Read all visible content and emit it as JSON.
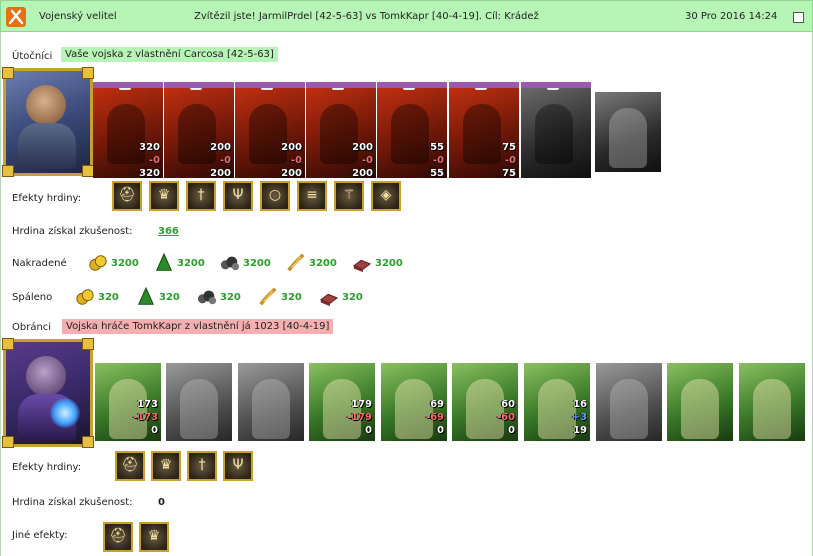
{
  "header": {
    "sender": "Vojenský velitel",
    "subject": "Zvítězil jste! JarmilPrdel [42-5-63] vs TomkKapr [40-4-19]. Cíl: Krádež",
    "date": "30 Pro 2016 14:24"
  },
  "attackers": {
    "label": "Útočníci",
    "tag": "Vaše vojska z vlastnění Carcosa [42-5-63]",
    "units": [
      {
        "icon": "demon-unit-icon",
        "n1": "320",
        "n2": "-0",
        "n3": "320"
      },
      {
        "icon": "fire-lord-unit-icon",
        "n1": "200",
        "n2": "-0",
        "n3": "200"
      },
      {
        "icon": "flame-beast-unit-icon",
        "n1": "200",
        "n2": "-0",
        "n3": "200"
      },
      {
        "icon": "dragon-unit-icon",
        "n1": "200",
        "n2": "-0",
        "n3": "200"
      },
      {
        "icon": "fire-elemental-unit-icon",
        "n1": "55",
        "n2": "-0",
        "n3": "55"
      },
      {
        "icon": "berserker-unit-icon",
        "n1": "75",
        "n2": "-0",
        "n3": "75"
      },
      {
        "icon": "dark-knight-unit-icon",
        "n1": "",
        "n2": "",
        "n3": ""
      },
      {
        "icon": "reaper-unit-icon",
        "n1": "",
        "n2": "",
        "n3": ""
      }
    ],
    "hero_effects_label": "Efekty hrdiny:",
    "hero_effects": [
      "helmet-effect-icon",
      "crown-effect-icon",
      "dagger-effect-icon",
      "trident-effect-icon",
      "ring-effect-icon",
      "scroll-effect-icon",
      "staff-effect-icon",
      "shield-effect-icon"
    ],
    "xp_label": "Hrdina získal zkušenost:",
    "xp_value": "366",
    "stolen_label": "Nakradené",
    "stolen": [
      {
        "icon": "gold-icon",
        "value": "3200"
      },
      {
        "icon": "wood-icon",
        "value": "3200"
      },
      {
        "icon": "ore-icon",
        "value": "3200"
      },
      {
        "icon": "grain-icon",
        "value": "3200"
      },
      {
        "icon": "brick-icon",
        "value": "3200"
      }
    ],
    "burned_label": "Spáleno",
    "burned": [
      {
        "icon": "gold-icon",
        "value": "320"
      },
      {
        "icon": "wood-icon",
        "value": "320"
      },
      {
        "icon": "ore-icon",
        "value": "320"
      },
      {
        "icon": "grain-icon",
        "value": "320"
      },
      {
        "icon": "brick-icon",
        "value": "320"
      }
    ]
  },
  "defenders": {
    "label": "Obránci",
    "tag": "Vojska hráče TomkKapr z vlastnění já 1023 [40-4-19]",
    "units": [
      {
        "icon": "dwarf-unit-icon",
        "n1": "173",
        "n2": "-173",
        "n3": "0"
      },
      {
        "icon": "swordsman-unit-icon",
        "n1": "",
        "n2": "",
        "n3": ""
      },
      {
        "icon": "knight-unit-icon",
        "n1": "",
        "n2": "",
        "n3": ""
      },
      {
        "icon": "griffin-unit-icon",
        "n1": "179",
        "n2": "-179",
        "n3": "0"
      },
      {
        "icon": "archer-unit-icon",
        "n1": "69",
        "n2": "-69",
        "n3": "0"
      },
      {
        "icon": "elf-warrior-unit-icon",
        "n1": "60",
        "n2": "-60",
        "n3": "0"
      },
      {
        "icon": "druid-unit-icon",
        "n1": "16",
        "n2": "+3",
        "n3": "19"
      },
      {
        "icon": "treant-gray-unit-icon",
        "n1": "",
        "n2": "",
        "n3": ""
      },
      {
        "icon": "tower-unit-icon",
        "n1": "",
        "n2": "",
        "n3": ""
      },
      {
        "icon": "tree-unit-icon",
        "n1": "",
        "n2": "",
        "n3": ""
      }
    ],
    "hero_effects_label": "Efekty hrdiny:",
    "hero_effects": [
      "mask-effect-icon",
      "axe-effect-icon",
      "arrow-effect-icon",
      "bracelet-effect-icon"
    ],
    "xp_label": "Hrdina získal zkušenost:",
    "xp_value": "0",
    "other_label": "Jiné efekty:",
    "other_effects": [
      "helm-effect-icon",
      "armor-effect-icon"
    ]
  },
  "colors": {
    "green_bar": "#b6f5b6",
    "red_tag": "#f4b0b0",
    "value_green": "#2aa02a",
    "loss_red": "#ff6a6a",
    "gain_blue": "#5aa0ff"
  }
}
